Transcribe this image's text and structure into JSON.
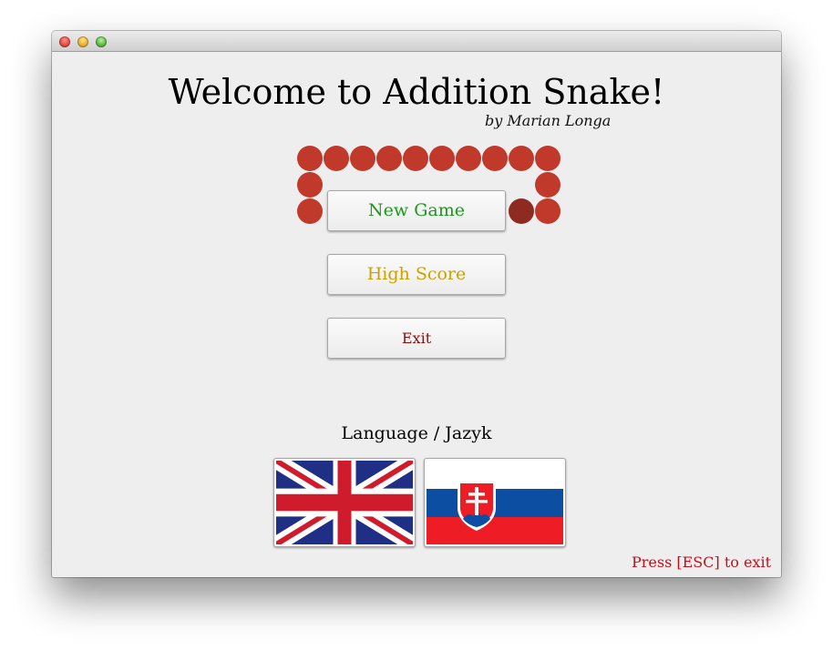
{
  "window": {
    "controls": [
      "close-icon",
      "minimize-icon",
      "maximize-icon"
    ]
  },
  "header": {
    "title": "Welcome to Addition Snake!",
    "author": "by Marian Longa"
  },
  "menu": {
    "new_game": "New Game",
    "high_score": "High Score",
    "exit": "Exit"
  },
  "language": {
    "label": "Language / Jazyk",
    "options": [
      "english-flag-icon",
      "slovak-flag-icon"
    ]
  },
  "footer": {
    "esc_hint": "Press [ESC] to exit"
  },
  "colors": {
    "snake": "#c0392b",
    "snake_head": "#8e2a22",
    "new_game": "#1a9a1a",
    "high_score": "#c9a100",
    "exit": "#8c0d0d",
    "esc_hint": "#c0101a"
  }
}
